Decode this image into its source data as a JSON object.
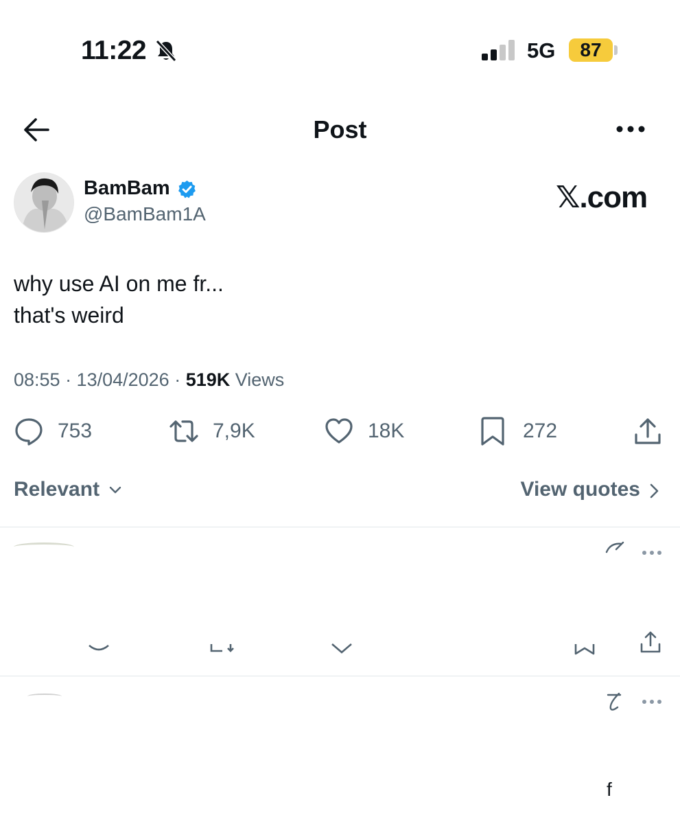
{
  "status_bar": {
    "time": "11:22",
    "network": "5G",
    "battery": "87"
  },
  "header": {
    "title": "Post"
  },
  "author": {
    "name": "BamBam",
    "handle": "@BamBam1A",
    "verified": true
  },
  "brand": "𝕏.com",
  "tweet": {
    "line1": "why use AI on me fr...",
    "line2": "that's weird",
    "time": "08:55 · 13/04/2026 · ",
    "views_count": "519K",
    "views_label": " Views"
  },
  "actions": {
    "replies": "753",
    "reposts": "7,9K",
    "likes": "18K",
    "bookmarks": "272"
  },
  "sort": {
    "relevant_label": "Relevant",
    "view_quotes_label": "View quotes"
  },
  "reply_fragments": {
    "second_reply_char": "f"
  },
  "colors": {
    "verified_blue": "#1d9bf0",
    "battery_yellow": "#f6cb3c",
    "secondary_text": "#536471"
  }
}
